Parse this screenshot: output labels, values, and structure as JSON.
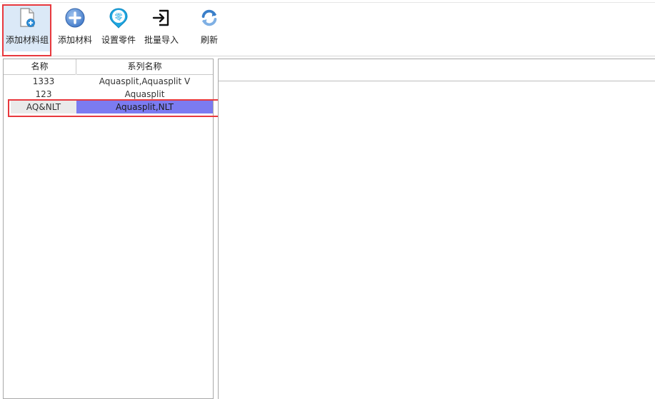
{
  "toolbar": {
    "buttons": [
      {
        "label": "添加材料组",
        "icon": "add-document-icon",
        "selected": true
      },
      {
        "label": "添加材料",
        "icon": "plus-circle-icon"
      },
      {
        "label": "设置零件",
        "icon": "part-pin-icon"
      },
      {
        "label": "批量导入",
        "icon": "import-icon"
      },
      {
        "label": "刷新",
        "icon": "refresh-icon"
      }
    ],
    "part_icon_glyph": "零"
  },
  "grid": {
    "columns": [
      "名称",
      "系列名称"
    ],
    "rows": [
      {
        "name": "1333",
        "series": "Aquasplit,Aquasplit V"
      },
      {
        "name": "123",
        "series": "Aquasplit"
      },
      {
        "name": "AQ&NLT",
        "series": "Aquasplit,NLT",
        "selected": true
      }
    ]
  },
  "colors": {
    "highlight": "#e8383d",
    "selection": "#7b7bf1",
    "toolbar_selected": "#dbe9f7"
  }
}
